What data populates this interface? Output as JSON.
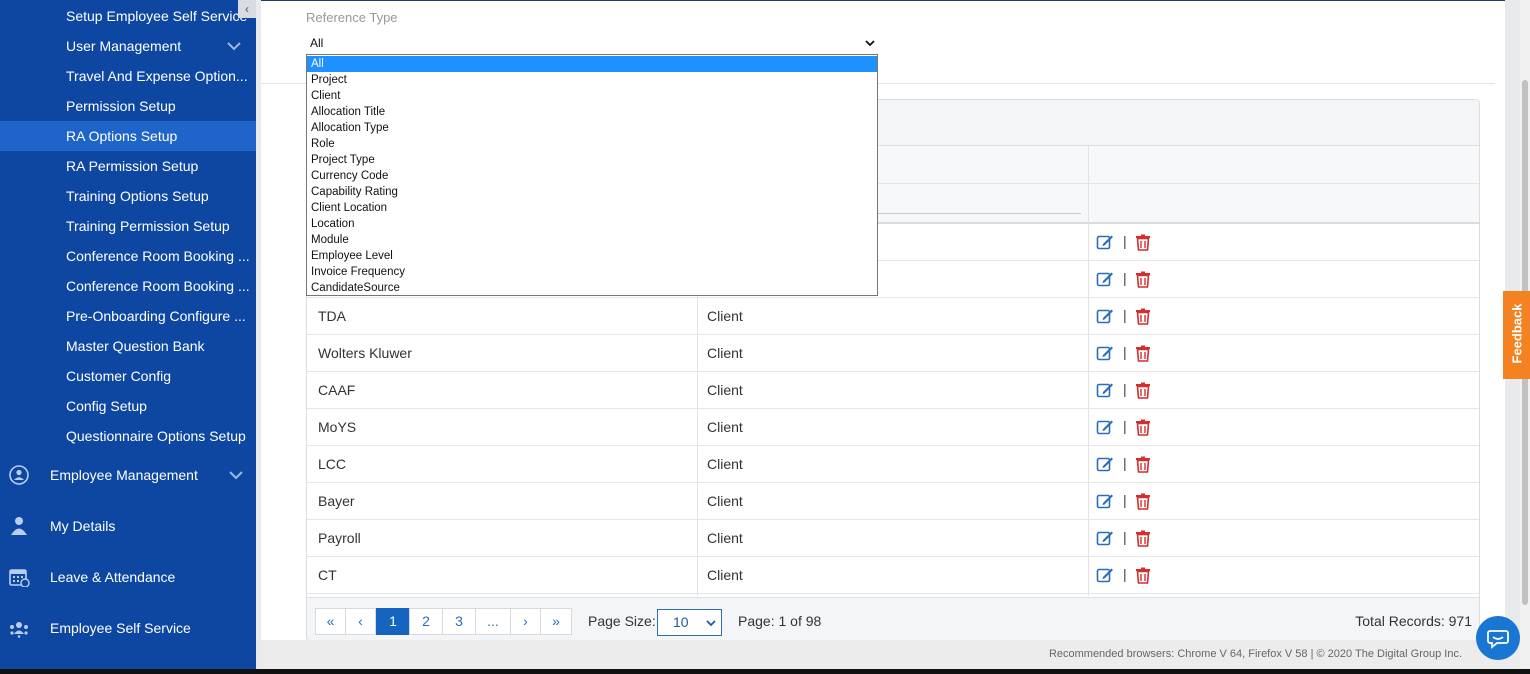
{
  "sidebar": {
    "sub_items": [
      {
        "label": "Setup Employee Self Service"
      },
      {
        "label": "User Management"
      },
      {
        "label": "Travel And Expense Option..."
      },
      {
        "label": "Permission Setup"
      },
      {
        "label": "RA Options Setup"
      },
      {
        "label": "RA Permission Setup"
      },
      {
        "label": "Training Options Setup"
      },
      {
        "label": "Training Permission Setup"
      },
      {
        "label": "Conference Room Booking ..."
      },
      {
        "label": "Conference Room Booking ..."
      },
      {
        "label": "Pre-Onboarding Configure ..."
      },
      {
        "label": "Master Question Bank"
      },
      {
        "label": "Customer Config"
      },
      {
        "label": "Config Setup"
      },
      {
        "label": "Questionnaire Options Setup"
      }
    ],
    "main_items": [
      {
        "label": "Employee Management",
        "icon": "employee-icon"
      },
      {
        "label": "My Details",
        "icon": "person-icon"
      },
      {
        "label": "Leave & Attendance",
        "icon": "calendar-icon"
      },
      {
        "label": "Employee Self Service",
        "icon": "group-icon"
      }
    ],
    "collapse_glyph": "‹",
    "accent": "#0d47a1",
    "active_color": "#1f64c8"
  },
  "filter": {
    "label": "Reference Type",
    "selected": "All",
    "options": [
      "All",
      "Project",
      "Client",
      "Allocation Title",
      "Allocation Type",
      "Role",
      "Project Type",
      "Currency Code",
      "Capability Rating",
      "Client Location",
      "Location",
      "Module",
      "Employee Level",
      "Invoice Frequency",
      "CandidateSource"
    ]
  },
  "grid": {
    "rows": [
      {
        "name": "TDA",
        "type": "Client"
      },
      {
        "name": "Wolters Kluwer",
        "type": "Client"
      },
      {
        "name": "CAAF",
        "type": "Client"
      },
      {
        "name": "MoYS",
        "type": "Client"
      },
      {
        "name": "LCC",
        "type": "Client"
      },
      {
        "name": "Bayer",
        "type": "Client"
      },
      {
        "name": "Payroll",
        "type": "Client"
      },
      {
        "name": "CT",
        "type": "Client"
      }
    ],
    "action_separator": "|"
  },
  "pager": {
    "first": "«",
    "prev": "‹",
    "pages": [
      "1",
      "2",
      "3",
      "..."
    ],
    "next": "›",
    "last": "»",
    "current_page": "1",
    "page_size_label": "Page Size:",
    "page_size": "10",
    "page_info": "Page: 1 of 98",
    "total": "Total Records: 971"
  },
  "footer": {
    "text": "Recommended browsers: Chrome V 64, Firefox V 58   |   © 2020 The Digital Group Inc."
  },
  "feedback": {
    "label": "Feedback",
    "color": "#f58220"
  }
}
